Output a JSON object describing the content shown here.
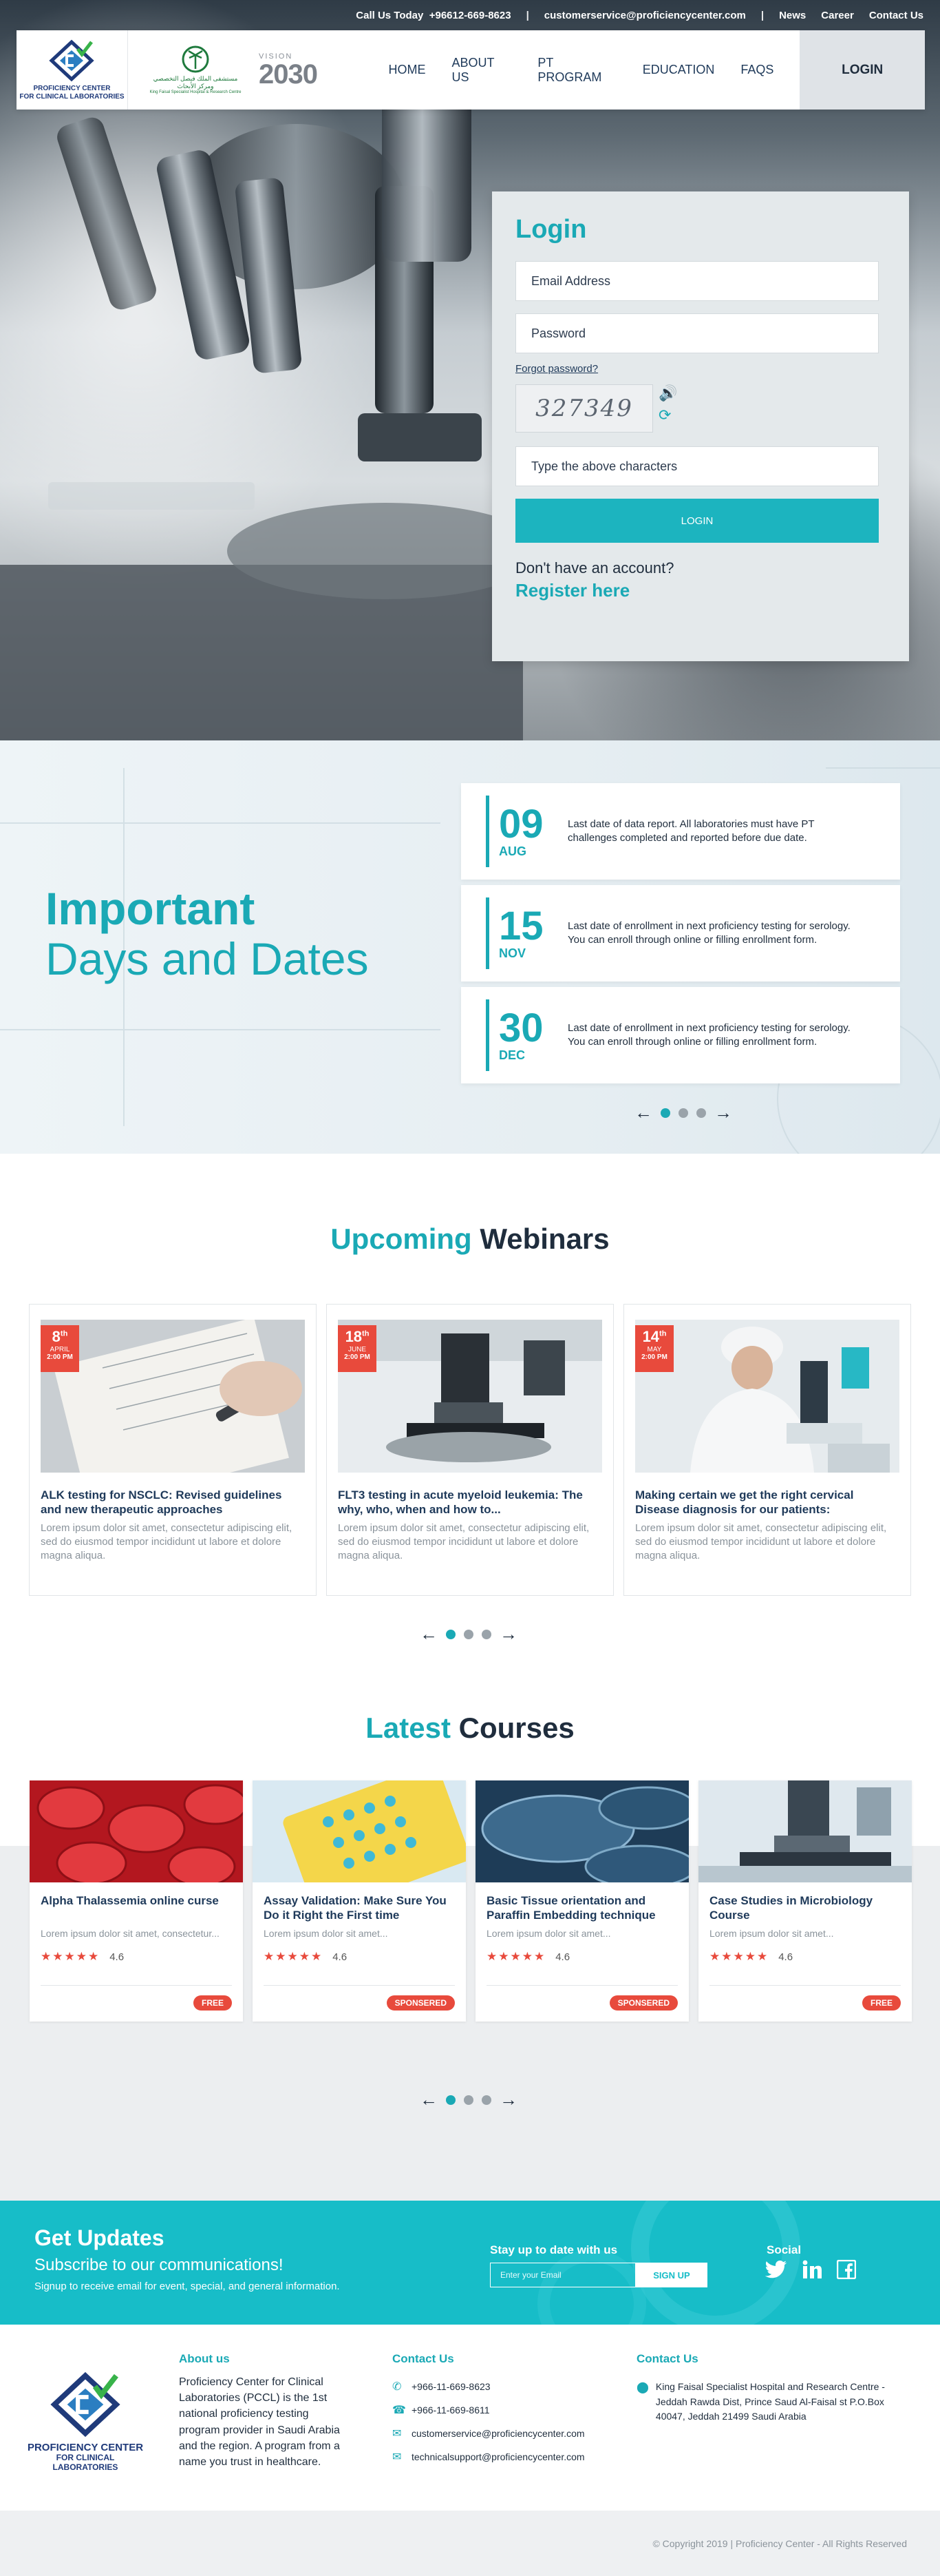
{
  "topbar": {
    "call_label": "Call Us Today",
    "phone": "+96612-669-8623",
    "separator": "|",
    "email": "customerservice@proficiencycenter.com",
    "links": [
      "News",
      "Career",
      "Contact Us"
    ]
  },
  "brand": {
    "logo_line1": "PROFICIENCY CENTER",
    "logo_line2": "FOR CLINICAL LABORATORIES",
    "partner_arabic": "مستشفى الملك فيصل التخصصي ومركز الأبحاث",
    "partner_english": "King Faisal Specialist Hospital & Research Centre",
    "vision_number": "2030",
    "vision_label": "VISION"
  },
  "nav": {
    "items": [
      "HOME",
      "ABOUT US",
      "PT PROGRAM",
      "EDUCATION",
      "FAQS"
    ],
    "login": "LOGIN"
  },
  "login": {
    "title": "Login",
    "email_placeholder": "Email Address",
    "password_placeholder": "Password",
    "forgot": "Forgot password?",
    "captcha_text": "327349",
    "captcha_placeholder": "Type the above characters",
    "submit": "LOGIN",
    "no_account": "Don't have an account?",
    "register": "Register here"
  },
  "dates": {
    "title_line1": "Important",
    "title_line2": "Days and Dates",
    "items": [
      {
        "day": "09",
        "month": "AUG",
        "text": "Last date of data report. All laboratories must have PT challenges completed and reported before due date."
      },
      {
        "day": "15",
        "month": "NOV",
        "text": "Last date of enrollment in next proficiency testing for serology. You can enroll through online or filling enrollment form."
      },
      {
        "day": "30",
        "month": "DEC",
        "text": "Last date of enrollment in next proficiency testing for serology. You can enroll through online or filling enrollment form."
      }
    ],
    "pager": {
      "prev": "←",
      "next": "→"
    }
  },
  "webinars": {
    "title_highlight": "Upcoming",
    "title_rest": "Webinars",
    "items": [
      {
        "day": "8",
        "sup": "th",
        "month": "APRIL",
        "time": "2:00 PM",
        "title": "ALK testing for NSCLC: Revised guidelines and new therapeutic approaches",
        "desc": "Lorem ipsum dolor sit amet, consectetur adipiscing elit, sed do eiusmod tempor incididunt ut labore et dolore magna aliqua."
      },
      {
        "day": "18",
        "sup": "th",
        "month": "JUNE",
        "time": "2:00 PM",
        "title": "FLT3 testing in acute myeloid leukemia: The why, who, when and how to...",
        "desc": "Lorem ipsum dolor sit amet, consectetur adipiscing elit, sed do eiusmod tempor incididunt ut labore et dolore magna aliqua."
      },
      {
        "day": "14",
        "sup": "th",
        "month": "MAY",
        "time": "2:00 PM",
        "title": "Making certain we get the right cervical Disease diagnosis for our patients:",
        "desc": "Lorem ipsum dolor sit amet, consectetur adipiscing elit, sed do eiusmod tempor incididunt ut labore et dolore magna aliqua."
      }
    ],
    "pager": {
      "prev": "←",
      "next": "→"
    }
  },
  "courses": {
    "title_highlight": "Latest",
    "title_rest": "Courses",
    "items": [
      {
        "title": "Alpha Thalassemia online curse",
        "desc": "Lorem ipsum dolor sit amet, consectetur...",
        "stars": "★★★★★",
        "rating": "4.6",
        "tag": "FREE"
      },
      {
        "title": "Assay Validation: Make Sure You Do it Right the First time",
        "desc": "Lorem ipsum dolor sit amet...",
        "stars": "★★★★★",
        "rating": "4.6",
        "tag": "SPONSERED"
      },
      {
        "title": "Basic Tissue orientation and Paraffin Embedding technique",
        "desc": "Lorem ipsum dolor sit amet...",
        "stars": "★★★★★",
        "rating": "4.6",
        "tag": "SPONSERED"
      },
      {
        "title": "Case Studies in Microbiology Course",
        "desc": "Lorem ipsum dolor sit amet...",
        "stars": "★★★★★",
        "rating": "4.6",
        "tag": "FREE"
      }
    ],
    "pager": {
      "prev": "←",
      "next": "→"
    }
  },
  "updates": {
    "title": "Get Updates",
    "subtitle": "Subscribe to our communications!",
    "small": "Signup to receive email for event, special, and general information.",
    "stay": "Stay up to date with us",
    "email_placeholder": "Enter your Email",
    "signup": "SIGN UP",
    "social_label": "Social"
  },
  "footer": {
    "about_title": "About us",
    "about_text": "Proficiency Center for Clinical Laboratories (PCCL) is the 1st national proficiency testing program provider in Saudi Arabia and the region. A program from a name you trust in healthcare.",
    "contact_title": "Contact Us",
    "phone1": "+966-11-669-8623",
    "phone2": "+966-11-669-8611",
    "email1": "customerservice@proficiencycenter.com",
    "email2": "technicalsupport@proficiencycenter.com",
    "contact2_title": "Contact Us",
    "address": "King Faisal Specialist Hospital and Research Centre - Jeddah Rawda Dist, Prince Saud Al-Faisal st P.O.Box 40047, Jeddah 21499 Saudi Arabia",
    "copyright": "© Copyright 2019 | Proficiency Center - All Rights Reserved"
  },
  "colors": {
    "accent": "#1aa9b5",
    "accent_bright": "#17bdc8",
    "badge_red": "#e84a3c",
    "navy": "#1f3a5a"
  }
}
